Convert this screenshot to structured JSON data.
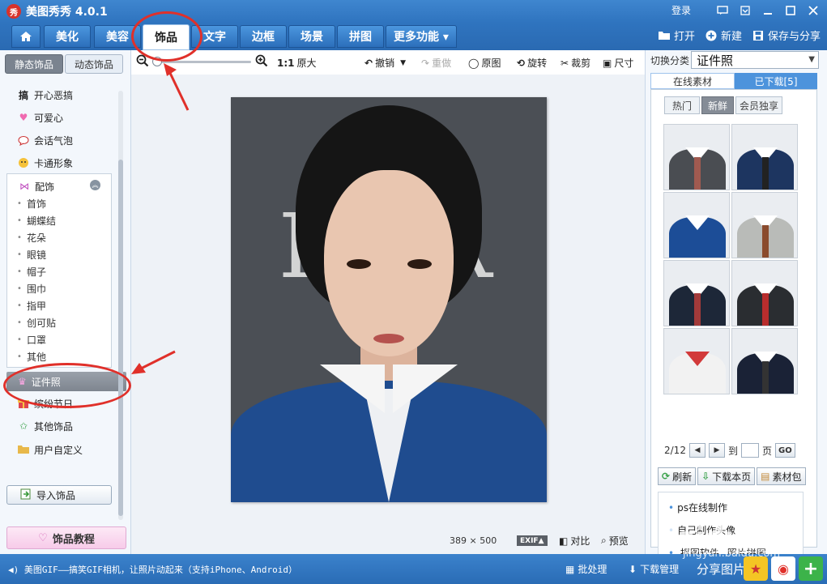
{
  "window": {
    "title": "美图秀秀 4.0.1",
    "logo_text": "秀",
    "login": "登录"
  },
  "tabs": [
    {
      "label": "美化"
    },
    {
      "label": "美容"
    },
    {
      "label": "饰品"
    },
    {
      "label": "文字"
    },
    {
      "label": "边框"
    },
    {
      "label": "场景"
    },
    {
      "label": "拼图"
    },
    {
      "label": "更多功能 ▾"
    }
  ],
  "top_actions": {
    "open": "打开",
    "new": "新建",
    "save": "保存与分享"
  },
  "left": {
    "tab_static": "静态饰品",
    "tab_dynamic": "动态饰品",
    "cats_top": [
      "开心恶搞",
      "可爱心",
      "会话气泡",
      "卡通形象"
    ],
    "expanded": "配饰",
    "subitems": [
      "首饰",
      "蝴蝶结",
      "花朵",
      "眼镜",
      "帽子",
      "围巾",
      "指甲",
      "创可贴",
      "口罩",
      "其他"
    ],
    "selected": "证件照",
    "cats_bottom": [
      "缤纷节日",
      "其他饰品",
      "用户自定义"
    ],
    "import": "导入饰品",
    "tutorial": "饰品教程"
  },
  "toolbar": {
    "ratio": "1:1",
    "original_size": "原大",
    "undo": "撤销",
    "redo": "重做",
    "original": "原图",
    "rotate": "旋转",
    "crop": "裁剪",
    "size": "尺寸"
  },
  "canvas": {
    "photo_text": "BAR",
    "dimensions": "389 × 500",
    "exif": "EXIF▲",
    "compare": "对比",
    "preview": "预览"
  },
  "right": {
    "switch_label": "切换分类",
    "category": "证件照",
    "tab_online": "在线素材",
    "tab_downloaded": "已下载[5]",
    "filters": [
      "热门",
      "新鲜",
      "会员独享"
    ],
    "thumbs": [
      {
        "suit": "#4a4d52",
        "tie": "#a05a50",
        "collar": true
      },
      {
        "suit": "#1d3560",
        "tie": "#222",
        "collar": true
      },
      {
        "suit": "#1c4d97",
        "tie": "",
        "collar": true
      },
      {
        "suit": "#b9bbb8",
        "tie": "#8a4b2d",
        "collar": true
      },
      {
        "suit": "#1d2738",
        "tie": "#a23a3a",
        "collar": true
      },
      {
        "suit": "#2a2d31",
        "tie": "#b82d2d",
        "collar": true
      },
      {
        "suit": "#f2f2f2",
        "tie": "",
        "collar": false
      },
      {
        "suit": "#1a2236",
        "tie": "#333",
        "collar": true
      }
    ],
    "page": "2/12",
    "to": "到",
    "page_unit": "页",
    "go": "GO",
    "refresh": "刷新",
    "download_page": "下载本页",
    "pack": "素材包",
    "links": [
      "ps在线制作",
      "自己制作头像",
      "抠图软件",
      "照片拼图"
    ]
  },
  "statusbar": {
    "marquee": "美图GIF——搞笑GIF相机，让照片动起来（支持iPhone、Android）",
    "batch": "批处理",
    "download_mgr": "下载管理",
    "share": "分享图片"
  },
  "watermark": {
    "main": "Baidu经验",
    "sub": "jingyan.baidu.com"
  },
  "colors": {
    "annotation": "#e0302a",
    "accent": "#2f74bf"
  }
}
